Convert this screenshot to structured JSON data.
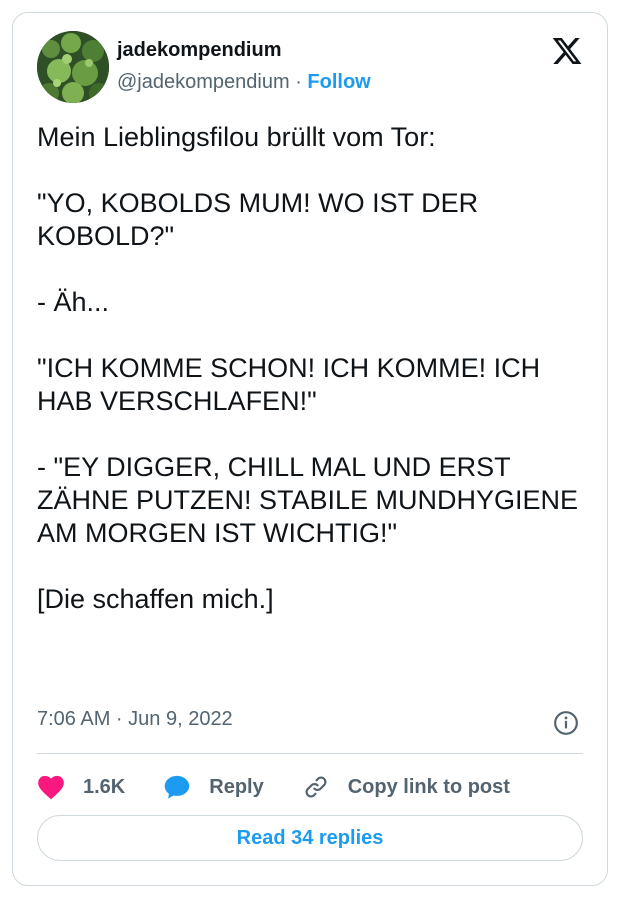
{
  "author": {
    "name": "jadekompendium",
    "handle": "@jadekompendium",
    "separator": "·",
    "follow_label": "Follow"
  },
  "tweet": {
    "paragraphs": [
      "Mein Lieblingsfilou brüllt vom Tor:",
      "\"YO, KOBOLDS MUM! WO IST DER KOBOLD?\"",
      "- Äh...",
      "\"ICH KOMME SCHON! ICH KOMME! ICH HAB VERSCHLAFEN!\"",
      "- \"EY DIGGER, CHILL MAL UND ERST ZÄHNE PUTZEN! STABILE MUNDHYGIENE AM MORGEN IST WICHTIG!\"",
      "[Die schaffen mich.]"
    ],
    "timestamp": "7:06 AM · Jun 9, 2022"
  },
  "actions": {
    "like_count": "1.6K",
    "reply_label": "Reply",
    "copy_label": "Copy link to post"
  },
  "read_replies_label": "Read 34 replies",
  "icons": {
    "platform": "x-logo-icon",
    "info": "info-icon",
    "like": "heart-icon",
    "reply": "speech-bubble-icon",
    "copy": "link-icon"
  },
  "colors": {
    "accent": "#1d9bf0",
    "like": "#f91880",
    "text": "#0f1419",
    "secondary": "#536471",
    "border": "#cfd9de"
  }
}
